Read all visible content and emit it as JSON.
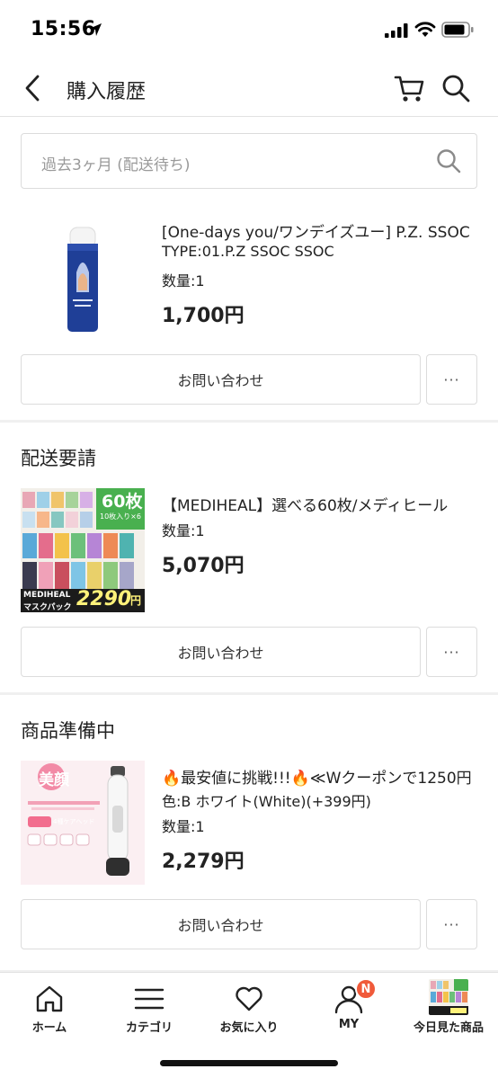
{
  "status_bar": {
    "time": "15:56"
  },
  "header": {
    "title": "購入履歴"
  },
  "filter": {
    "label": "過去3ヶ月 (配送待ち)"
  },
  "orders": [
    {
      "status": "",
      "product_name": "[One-days you/ワンデイズユー] P.Z. SSOC",
      "option": "TYPE:01.P.Z SSOC SSOC",
      "quantity": "数量:1",
      "price": "1,700円",
      "inquiry_label": "お問い合わせ",
      "more_label": "···"
    },
    {
      "status": "配送要請",
      "product_name": "【MEDIHEAL】選べる60枚/メディヒール",
      "thumb_badge": "60枚",
      "thumb_badge_sub": "10枚入り×6",
      "thumb_brand": "MEDIHEAL",
      "thumb_brand_sub": "マスクパック",
      "thumb_price": "2290",
      "thumb_price_unit": "円",
      "quantity": "数量:1",
      "price": "5,070円",
      "inquiry_label": "お問い合わせ",
      "more_label": "···"
    },
    {
      "status": "商品準備中",
      "product_name": "🔥最安値に挑戦!!!🔥≪Wクーポンで1250円",
      "option": "色:B ホワイト(White)(+399円)",
      "thumb_title": "美顔",
      "thumb_tag": "4種ケアヘッド",
      "quantity": "数量:1",
      "price": "2,279円",
      "inquiry_label": "お問い合わせ",
      "more_label": "···"
    }
  ],
  "bottom_nav": {
    "items": [
      {
        "label": "ホーム",
        "icon": "home-icon"
      },
      {
        "label": "カテゴリ",
        "icon": "menu-icon"
      },
      {
        "label": "お気に入り",
        "icon": "heart-icon"
      },
      {
        "label": "MY",
        "icon": "person-icon",
        "badge": "N"
      },
      {
        "label": "今日見た商品",
        "icon": "recent-product-thumbnail"
      }
    ]
  },
  "colors": {
    "badge": "#f05a3a",
    "divider": "#f0f0f0",
    "text": "#222222"
  }
}
